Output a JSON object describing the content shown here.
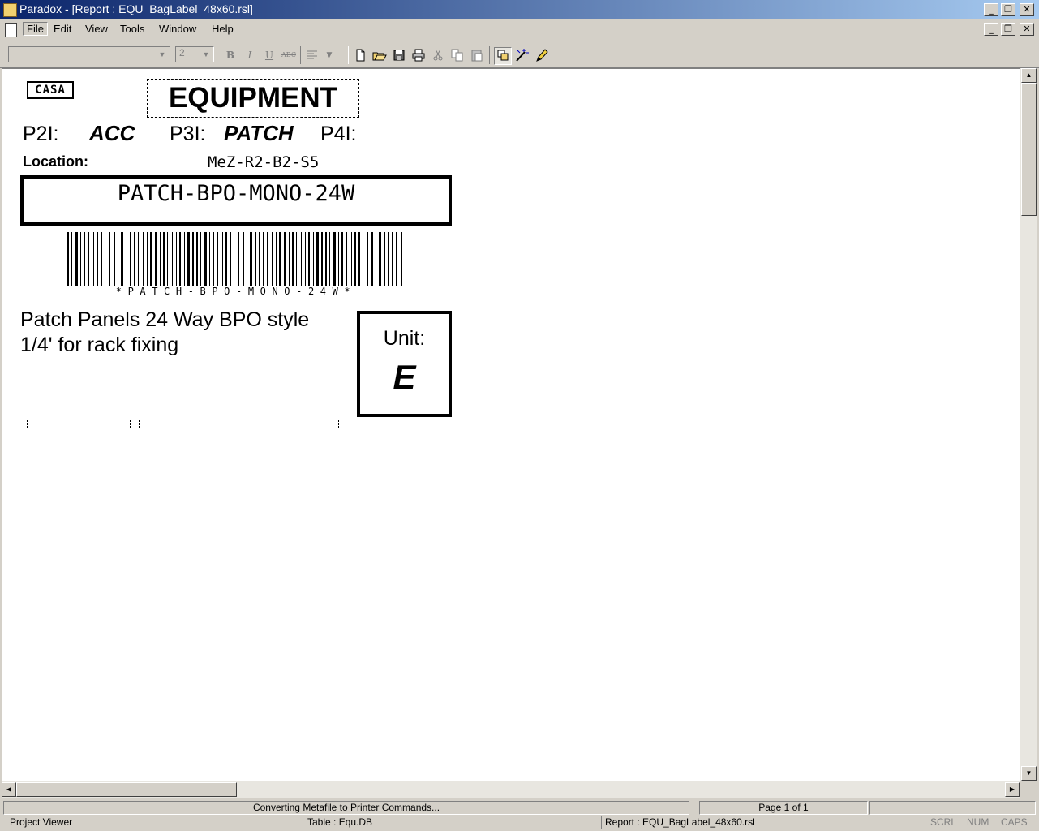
{
  "window": {
    "title": "Paradox - [Report : EQU_BagLabel_48x60.rsl]",
    "buttons": {
      "minimize": "_",
      "restore": "❐",
      "close": "✕"
    }
  },
  "menu": {
    "items": [
      "File",
      "Edit",
      "View",
      "Tools",
      "Window",
      "Help"
    ]
  },
  "toolbar": {
    "font_name": "",
    "font_size": "2",
    "bold": "B",
    "italic": "I",
    "underline": "U",
    "strike": "ABC",
    "icons": [
      "new-icon",
      "open-icon",
      "save-icon",
      "print-icon",
      "cut-icon",
      "copy-icon",
      "paste-icon",
      "properties-icon",
      "magic-wand-icon",
      "pencil-icon"
    ]
  },
  "label": {
    "logo": "CASA",
    "heading": "EQUIPMENT",
    "p2_label": "P2I:",
    "p2_value": "ACC",
    "p3_label": "P3I:",
    "p3_value": "PATCH",
    "p4_label": "P4I:",
    "location_label": "Location:",
    "location_value": "MeZ-R2-B2-S5",
    "code": "PATCH-BPO-MONO-24W",
    "barcode_text": "*PATCH-BPO-MONO-24W*",
    "description_line1": "Patch Panels 24 Way BPO style",
    "description_line2": "1/4' for rack fixing",
    "unit_label": "Unit:",
    "unit_value": "E"
  },
  "status": {
    "message": "Converting Metafile to Printer Commands...",
    "page": "Page 1 of 1",
    "project_viewer": "Project Viewer",
    "table": "Table : Equ.DB",
    "report": "Report : EQU_BagLabel_48x60.rsl",
    "scrl": "SCRL",
    "num": "NUM",
    "caps": "CAPS"
  },
  "colors": {
    "title_gradient_start": "#0a246a",
    "title_gradient_end": "#a6caf0",
    "chrome": "#d4d0c8"
  }
}
